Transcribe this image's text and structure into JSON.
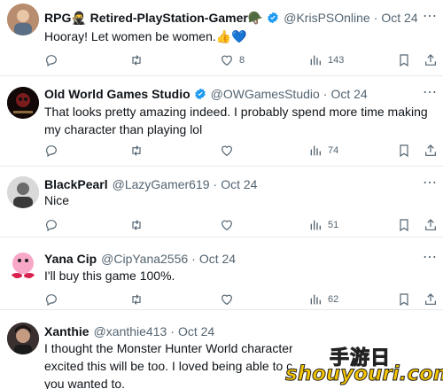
{
  "tweets": [
    {
      "name": "RPG🥷 Retired-PlayStation-Gamer🪖",
      "handle": "@KrisPSOnline",
      "date": "Oct 24",
      "text": "Hooray! Let women be women.👍💙",
      "reply_count": "",
      "retweet_count": "",
      "like_count": "8",
      "view_count": "143"
    },
    {
      "name": "Old World Games Studio",
      "handle": "@OWGamesStudio",
      "date": "Oct 24",
      "text": "That looks pretty amazing indeed. I probably spend more time making my character than playing lol",
      "like_count": "",
      "view_count": "74"
    },
    {
      "name": "BlackPearl",
      "handle": "@LazyGamer619",
      "date": "Oct 24",
      "text": "Nice",
      "like_count": "",
      "view_count": "51"
    },
    {
      "name": "Yana Cip",
      "handle": "@CipYana2556",
      "date": "Oct 24",
      "text": "I'll buy this game 100%.",
      "like_count": "",
      "view_count": "62"
    },
    {
      "name": "Xanthie",
      "handle": "@xanthie413",
      "date": "Oct 24",
      "text_lines": [
        "I thought the Monster Hunter World character c",
        "excited this will be too. I loved being able to ch",
        "you wanted to."
      ]
    }
  ],
  "icons": [
    "reply-icon",
    "retweet-icon",
    "like-icon",
    "views-icon",
    "bookmark-icon",
    "share-icon",
    "verified-icon",
    "more-icon"
  ],
  "colors": {
    "verified": "#1d9bf0",
    "secondary_text": "#536471",
    "divider": "#e6e9ec",
    "watermark": "#f5c400"
  },
  "watermark": {
    "cn": "手游日",
    "en": "shouyouri.com"
  }
}
